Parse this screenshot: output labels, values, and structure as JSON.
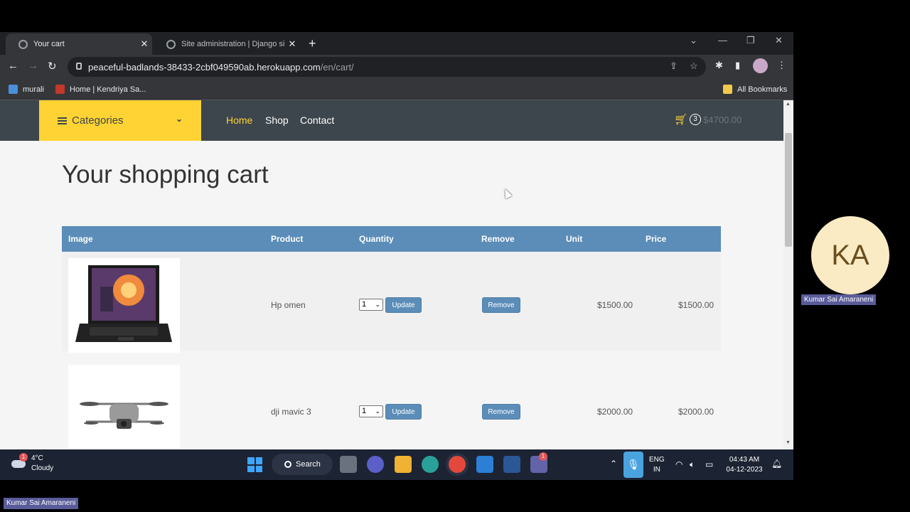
{
  "browser": {
    "tabs": [
      {
        "title": "Your cart",
        "active": true
      },
      {
        "title": "Site administration | Django site",
        "active": false
      }
    ],
    "url_host": "peaceful-badlands-38433-2cbf049590ab.herokuapp.com",
    "url_path": "/en/cart/",
    "bookmarks": [
      "murali",
      "Home | Kendriya Sa..."
    ],
    "all_bookmarks_label": "All Bookmarks"
  },
  "site": {
    "categories_label": "Categories",
    "nav": [
      "Home",
      "Shop",
      "Contact"
    ],
    "cart_count": "3",
    "cart_total": "$4700.00",
    "accent": "#ffd333",
    "nav_bg": "#3d464d"
  },
  "cart": {
    "heading": "Your shopping cart",
    "columns": [
      "Image",
      "Product",
      "Quantity",
      "Remove",
      "Unit",
      "Price"
    ],
    "header_color": "#5b8db8",
    "rows": [
      {
        "product": "Hp omen",
        "quantity": "1",
        "update_label": "Update",
        "remove_label": "Remove",
        "unit": "$1500.00",
        "price": "$1500.00",
        "image_icon": "laptop-icon"
      },
      {
        "product": "dji mavic 3",
        "quantity": "1",
        "update_label": "Update",
        "remove_label": "Remove",
        "unit": "$2000.00",
        "price": "$2000.00",
        "image_icon": "drone-icon"
      }
    ]
  },
  "taskbar": {
    "weather_badge": "1",
    "temperature": "4°C",
    "condition": "Cloudy",
    "search_label": "Search",
    "lang_line1": "ENG",
    "lang_line2": "IN",
    "time": "04:43 AM",
    "date": "04-12-2023",
    "teams_badge": "1"
  },
  "meeting": {
    "participant_initials": "KA",
    "participant_name": "Kumar Sai Amaraneni",
    "self_name": "Kumar Sai Amaraneni"
  }
}
